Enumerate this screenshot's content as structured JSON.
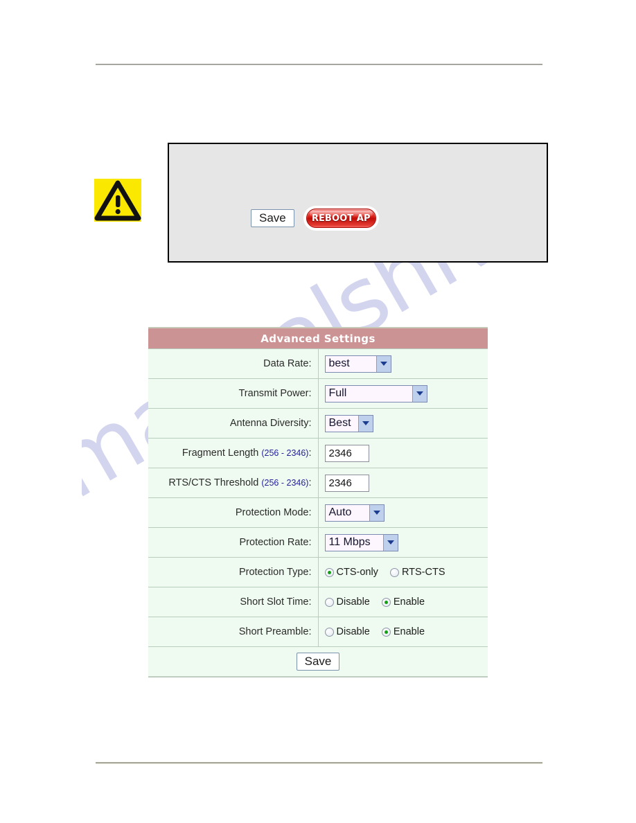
{
  "page": {
    "watermark_text": "manualshive.com"
  },
  "notice_box": {
    "warning_icon": "warning-triangle-icon",
    "save_label": "Save",
    "reboot_label": "REBOOT AP"
  },
  "settings": {
    "title": "Advanced Settings",
    "save_label": "Save",
    "rows": [
      {
        "label": "Data Rate:",
        "control": "select",
        "value": "best"
      },
      {
        "label": "Transmit Power:",
        "control": "select",
        "value": "Full"
      },
      {
        "label": "Antenna Diversity:",
        "control": "select",
        "value": "Best"
      },
      {
        "label": "Fragment Length ",
        "hint": "(256 - 2346)",
        "label_suffix": ":",
        "control": "text",
        "value": "2346"
      },
      {
        "label": "RTS/CTS Threshold ",
        "hint": "(256 - 2346)",
        "label_suffix": ":",
        "control": "text",
        "value": "2346"
      },
      {
        "label": "Protection Mode:",
        "control": "select",
        "value": "Auto"
      },
      {
        "label": "Protection Rate:",
        "control": "select",
        "value": "11 Mbps"
      },
      {
        "label": "Protection Type:",
        "control": "radio",
        "options": [
          "CTS-only",
          "RTS-CTS"
        ],
        "selected": "CTS-only"
      },
      {
        "label": "Short Slot Time:",
        "control": "radio",
        "options": [
          "Disable",
          "Enable"
        ],
        "selected": "Enable"
      },
      {
        "label": "Short Preamble:",
        "control": "radio",
        "options": [
          "Disable",
          "Enable"
        ],
        "selected": "Enable"
      }
    ]
  },
  "colors": {
    "header_rose": "#cc9394",
    "row_mint": "#effbf0",
    "hint_blue": "#24219c",
    "radio_green": "#12a112",
    "reboot_red": "#c00d09",
    "warning_yellow": "#fbe800",
    "watermark": "#b9bce6"
  }
}
